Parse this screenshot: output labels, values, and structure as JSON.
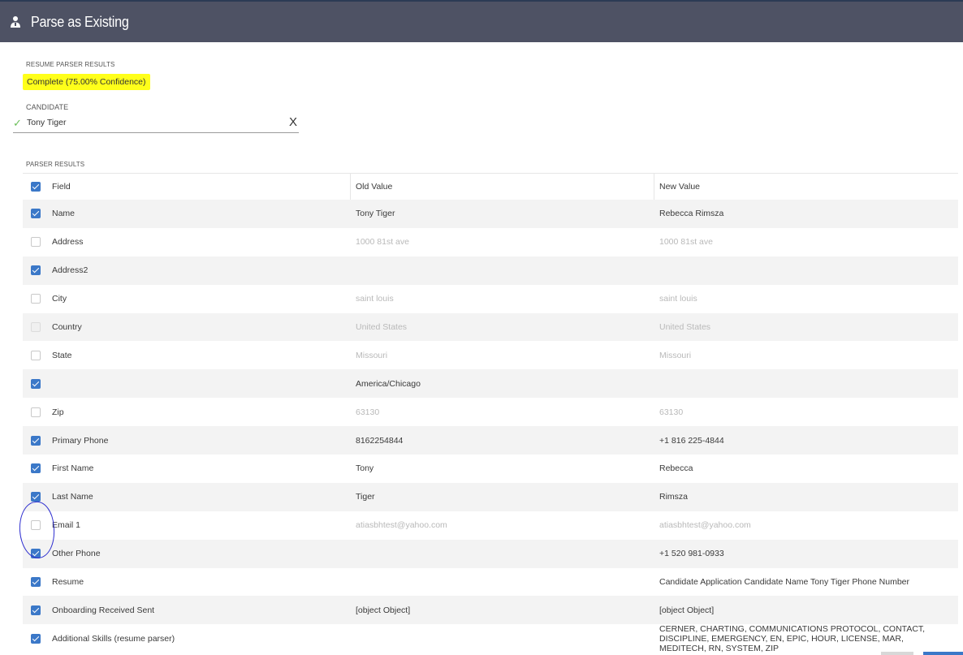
{
  "header": {
    "title": "Parse as Existing",
    "icon": "user-icon"
  },
  "resume_parser": {
    "label": "RESUME PARSER RESULTS",
    "status": "Complete (75.00% Confidence)",
    "status_highlight_color": "#ffff1a"
  },
  "candidate": {
    "label": "CANDIDATE",
    "value": "Tony Tiger",
    "clear_label": "X",
    "check_label": "✓"
  },
  "parser_results": {
    "label": "PARSER RESULTS",
    "columns": {
      "field": "Field",
      "old": "Old Value",
      "new": "New Value"
    },
    "header_checked": true,
    "rows": [
      {
        "field": "Name",
        "old": "Tony Tiger",
        "new": "Rebecca Rimsza",
        "state": "on"
      },
      {
        "field": "Address",
        "old": "1000 81st ave",
        "new": "1000 81st ave",
        "state": "off"
      },
      {
        "field": "Address2",
        "old": "",
        "new": "",
        "state": "on"
      },
      {
        "field": "City",
        "old": "saint louis",
        "new": "saint louis",
        "state": "off"
      },
      {
        "field": "Country",
        "old": "United States",
        "new": "United States",
        "state": "dis"
      },
      {
        "field": "State",
        "old": "Missouri",
        "new": "Missouri",
        "state": "off"
      },
      {
        "field": "",
        "old": "America/Chicago",
        "new": "",
        "state": "on"
      },
      {
        "field": "Zip",
        "old": "63130",
        "new": "63130",
        "state": "off"
      },
      {
        "field": "Primary Phone",
        "old": "8162254844",
        "new": "+1 816 225-4844",
        "state": "on"
      },
      {
        "field": "First Name",
        "old": "Tony",
        "new": "Rebecca",
        "state": "on"
      },
      {
        "field": "Last Name",
        "old": "Tiger",
        "new": "Rimsza",
        "state": "on"
      },
      {
        "field": "Email 1",
        "old": "atiasbhtest@yahoo.com",
        "new": "atiasbhtest@yahoo.com",
        "state": "off"
      },
      {
        "field": "Other Phone",
        "old": "",
        "new": "+1 520 981-0933",
        "state": "on"
      },
      {
        "field": "Resume",
        "old": "",
        "new": " Candidate Application   Candidate Name Tony Tiger Phone Number",
        "state": "on"
      },
      {
        "field": "Onboarding Received Sent",
        "old": "[object Object]",
        "new": "[object Object]",
        "state": "on"
      },
      {
        "field": "Additional Skills (resume parser)",
        "old": "",
        "new": "CERNER, CHARTING, COMMUNICATIONS PROTOCOL, CONTACT, DISCIPLINE, EMERGENCY, EN, EPIC, HOUR, LICENSE, MAR, MEDITECH, RN, SYSTEM, ZIP",
        "state": "on"
      }
    ]
  },
  "colors": {
    "header_bg": "#4e5264",
    "accent": "#3b78c8",
    "annotation": "#2f2fd0"
  }
}
